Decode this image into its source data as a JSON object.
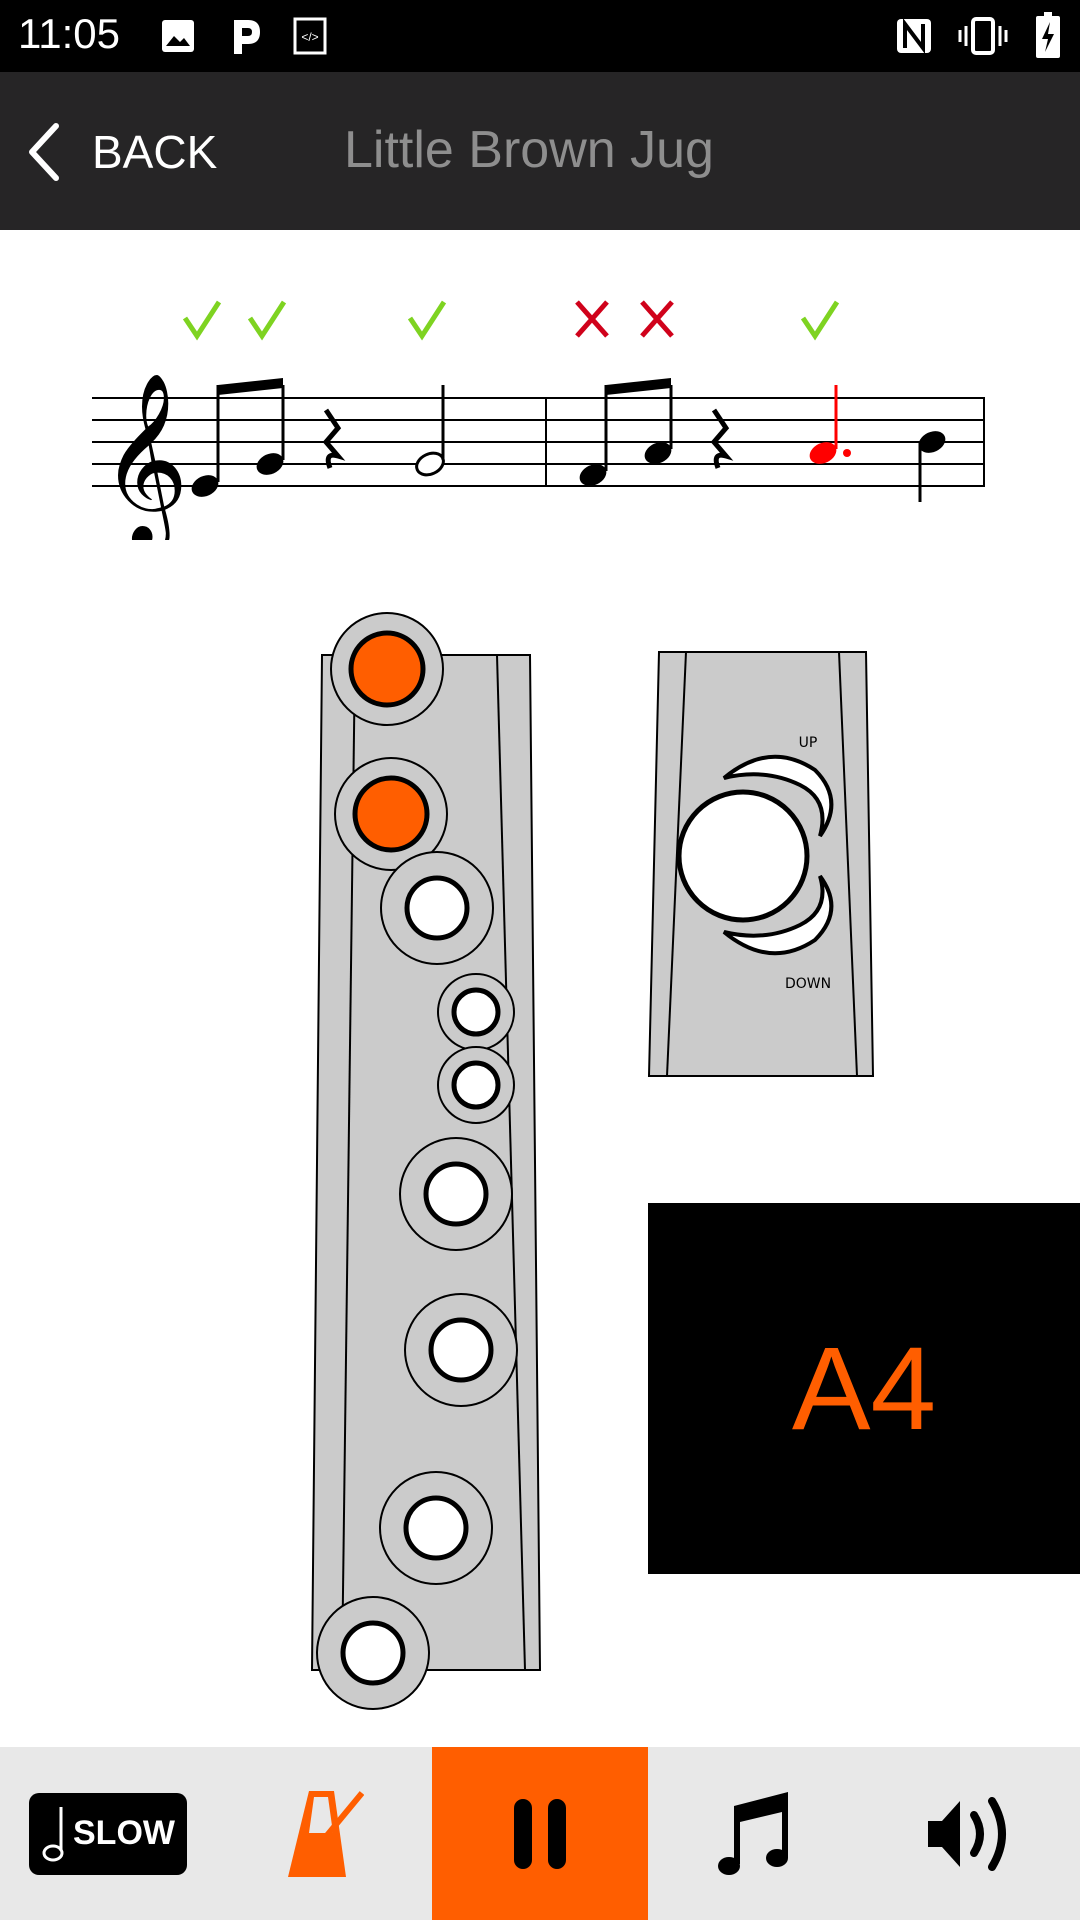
{
  "status_bar": {
    "time": "11:05",
    "left_icons": [
      "image-icon",
      "parking-p-icon",
      "code-icon"
    ],
    "right_icons": [
      "nfc-icon",
      "vibrate-icon",
      "battery-charging-icon"
    ]
  },
  "app_bar": {
    "back_label": "BACK",
    "title": "Little Brown Jug"
  },
  "score": {
    "clef": "treble",
    "notes": [
      {
        "pitch": "E4",
        "duration": "eighth",
        "result": "correct"
      },
      {
        "pitch": "G4",
        "duration": "eighth",
        "result": "correct"
      },
      {
        "pitch": "rest",
        "duration": "quarter",
        "result": null
      },
      {
        "pitch": "G4",
        "duration": "half",
        "result": "correct"
      },
      {
        "pitch": "F4",
        "duration": "eighth",
        "result": "wrong"
      },
      {
        "pitch": "A4",
        "duration": "eighth",
        "result": "wrong"
      },
      {
        "pitch": "rest",
        "duration": "quarter",
        "result": null
      },
      {
        "pitch": "A4",
        "duration": "dotted-quarter",
        "result": "correct",
        "current": true
      },
      {
        "pitch": "B4",
        "duration": "eighth",
        "result": null
      }
    ],
    "colors": {
      "correct": "#7ed321",
      "wrong": "#d0021b",
      "current": "#ff0000"
    }
  },
  "fingering": {
    "holes_closed": [
      true,
      true,
      false,
      false,
      false,
      false,
      false,
      false,
      false
    ],
    "closed_color": "#ff5e00",
    "octave_key": {
      "up_label": "UP",
      "down_label": "DOWN"
    }
  },
  "current_note": "A4",
  "toolbar": {
    "slow_label": "SLOW",
    "items": [
      "slow-button",
      "metronome-button",
      "pause-button",
      "notes-button",
      "volume-button"
    ],
    "active": "pause-button",
    "accent": "#ff5e00"
  }
}
